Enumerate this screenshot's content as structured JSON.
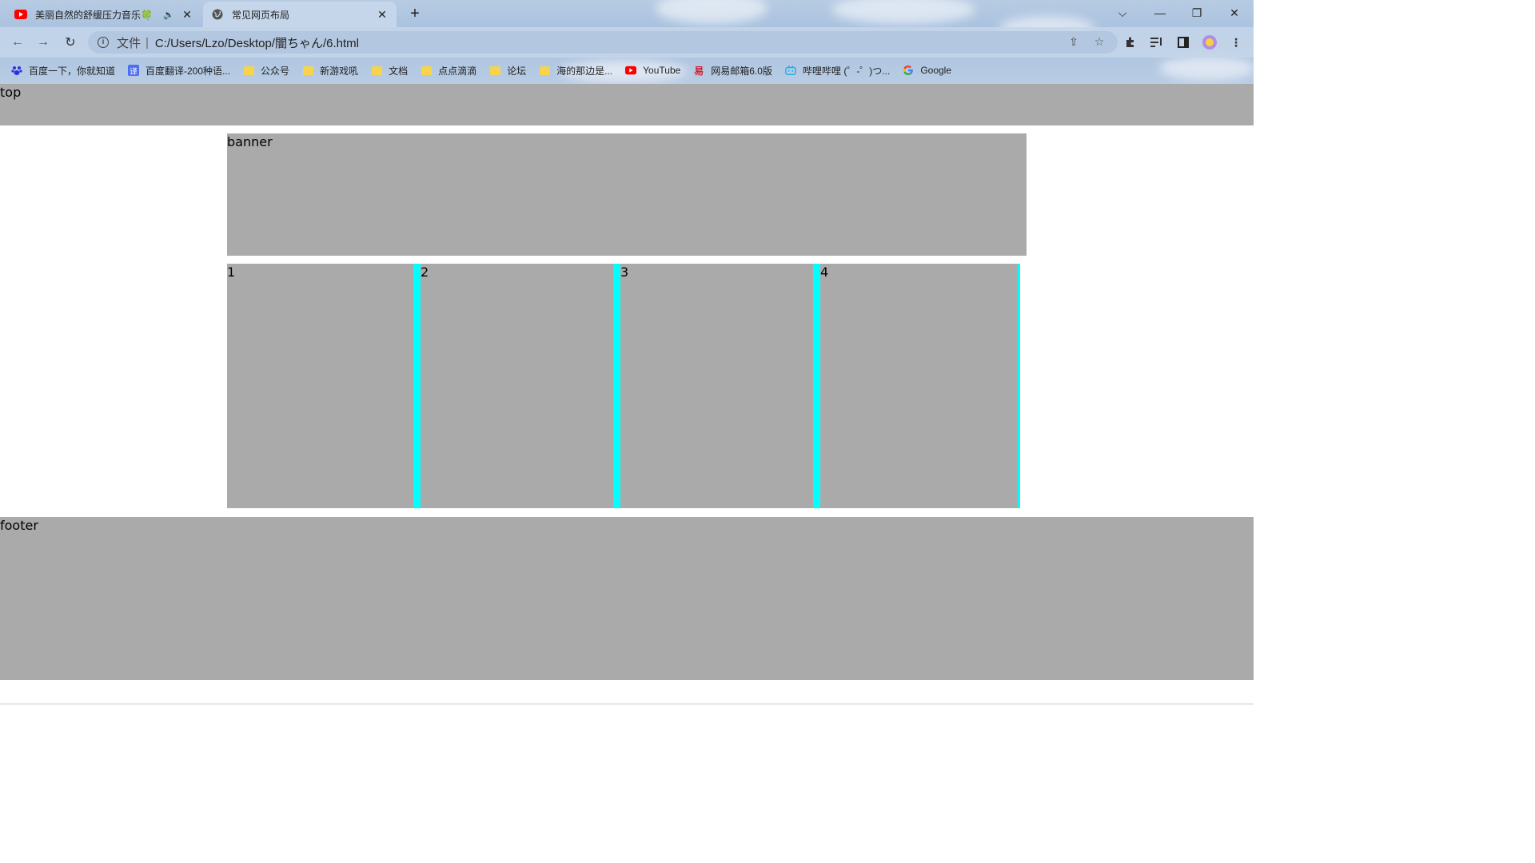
{
  "browser": {
    "tabs": [
      {
        "title": "美丽自然的舒缓压力音乐🍀",
        "favicon": "youtube-icon",
        "audio": "🔈"
      },
      {
        "title": "常见网页布局",
        "favicon": "globe-icon"
      }
    ],
    "new_tab": "+",
    "window_controls": {
      "dropdown": "⌵",
      "minimize": "—",
      "restore": "❐",
      "close": "✕"
    },
    "address": {
      "scheme_label": "文件",
      "separator": "|",
      "url": "C:/Users/Lzo/Desktop/闇ちゃん/6.html"
    },
    "bookmarks": [
      {
        "label": "百度一下，你就知道",
        "icon": "baidu-icon"
      },
      {
        "label": "百度翻译-200种语...",
        "icon": "translate-icon"
      },
      {
        "label": "公众号",
        "icon": "folder-icon"
      },
      {
        "label": "新游戏吼",
        "icon": "folder-icon"
      },
      {
        "label": "文档",
        "icon": "folder-icon"
      },
      {
        "label": "点点滴滴",
        "icon": "folder-icon"
      },
      {
        "label": "论坛",
        "icon": "folder-icon"
      },
      {
        "label": "海的那边是...",
        "icon": "folder-icon"
      },
      {
        "label": "YouTube",
        "icon": "youtube-icon"
      },
      {
        "label": "网易邮箱6.0版",
        "icon": "netease-mail-icon"
      },
      {
        "label": "哔哩哔哩 (゜-゜)つ...",
        "icon": "bilibili-icon"
      },
      {
        "label": "Google",
        "icon": "google-icon"
      }
    ]
  },
  "page": {
    "top": "top",
    "banner": "banner",
    "columns": [
      "1",
      "2",
      "3",
      "4"
    ],
    "footer": "footer",
    "colors": {
      "block": "#aaaaaa",
      "border": "#00ffff"
    }
  }
}
